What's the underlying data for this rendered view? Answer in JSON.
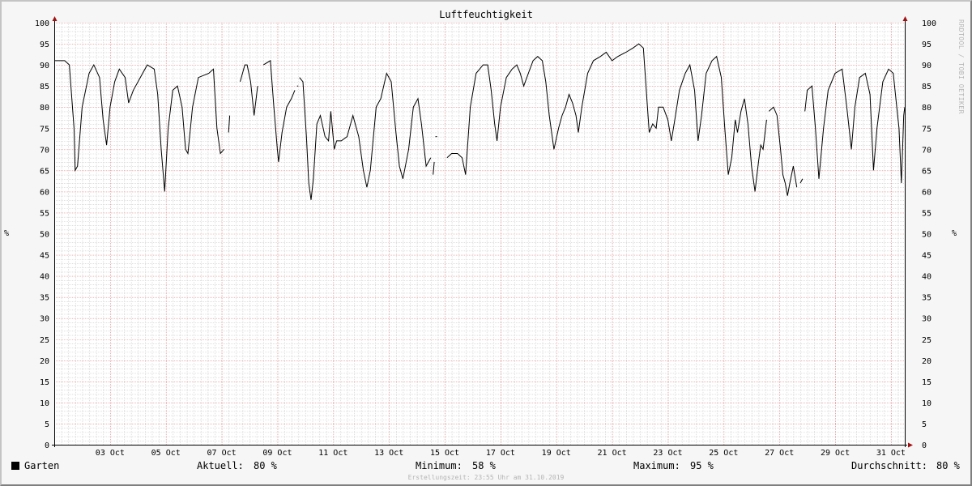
{
  "chart_data": {
    "type": "line",
    "title": "Luftfeuchtigkeit",
    "ylabel": "%",
    "ylim": [
      0,
      100
    ],
    "y_ticks": [
      0,
      5,
      10,
      15,
      20,
      25,
      30,
      35,
      40,
      45,
      50,
      55,
      60,
      65,
      70,
      75,
      80,
      85,
      90,
      95,
      100
    ],
    "x_range": [
      "2019-10-01T12:00",
      "2019-10-31T23:55"
    ],
    "x_ticks": [
      {
        "date": "2019-10-03",
        "label": "03 Oct"
      },
      {
        "date": "2019-10-05",
        "label": "05 Oct"
      },
      {
        "date": "2019-10-07",
        "label": "07 Oct"
      },
      {
        "date": "2019-10-09",
        "label": "09 Oct"
      },
      {
        "date": "2019-10-11",
        "label": "11 Oct"
      },
      {
        "date": "2019-10-13",
        "label": "13 Oct"
      },
      {
        "date": "2019-10-15",
        "label": "15 Oct"
      },
      {
        "date": "2019-10-17",
        "label": "17 Oct"
      },
      {
        "date": "2019-10-19",
        "label": "19 Oct"
      },
      {
        "date": "2019-10-21",
        "label": "21 Oct"
      },
      {
        "date": "2019-10-23",
        "label": "23 Oct"
      },
      {
        "date": "2019-10-25",
        "label": "25 Oct"
      },
      {
        "date": "2019-10-27",
        "label": "27 Oct"
      },
      {
        "date": "2019-10-29",
        "label": "29 Oct"
      },
      {
        "date": "2019-10-31",
        "label": "31 Oct"
      }
    ],
    "grid": true,
    "series": [
      {
        "name": "Garten",
        "color": "#000000",
        "segments": [
          [
            [
              "2019-10-01T12:00",
              91
            ],
            [
              "2019-10-01T21:00",
              91
            ],
            [
              "2019-10-02T01:00",
              90
            ],
            [
              "2019-10-02T05:00",
              75
            ],
            [
              "2019-10-02T06:00",
              65
            ],
            [
              "2019-10-02T08:00",
              66
            ],
            [
              "2019-10-02T12:00",
              80
            ],
            [
              "2019-10-02T18:00",
              88
            ],
            [
              "2019-10-02T22:00",
              90
            ],
            [
              "2019-10-03T03:00",
              87
            ],
            [
              "2019-10-03T06:00",
              77
            ],
            [
              "2019-10-03T09:00",
              71
            ],
            [
              "2019-10-03T12:00",
              80
            ],
            [
              "2019-10-03T16:00",
              86
            ],
            [
              "2019-10-03T20:00",
              89
            ],
            [
              "2019-10-04T01:00",
              87
            ],
            [
              "2019-10-04T04:00",
              81
            ],
            [
              "2019-10-04T08:00",
              84
            ],
            [
              "2019-10-04T14:00",
              87
            ],
            [
              "2019-10-04T20:00",
              90
            ],
            [
              "2019-10-05T02:00",
              89
            ],
            [
              "2019-10-05T05:00",
              83
            ],
            [
              "2019-10-05T08:00",
              70
            ],
            [
              "2019-10-05T11:00",
              60
            ],
            [
              "2019-10-05T14:00",
              75
            ],
            [
              "2019-10-05T18:00",
              84
            ],
            [
              "2019-10-05T22:00",
              85
            ],
            [
              "2019-10-06T02:00",
              80
            ],
            [
              "2019-10-06T05:00",
              70
            ],
            [
              "2019-10-06T07:00",
              69
            ],
            [
              "2019-10-06T11:00",
              80
            ],
            [
              "2019-10-06T16:00",
              87
            ],
            [
              "2019-10-07T01:00",
              88
            ],
            [
              "2019-10-07T05:00",
              89
            ],
            [
              "2019-10-07T08:00",
              75
            ],
            [
              "2019-10-07T11:00",
              69
            ],
            [
              "2019-10-07T14:00",
              70
            ]
          ],
          [
            [
              "2019-10-07T18:00",
              74
            ],
            [
              "2019-10-07T19:00",
              78
            ]
          ],
          [
            [
              "2019-10-08T04:00",
              86
            ],
            [
              "2019-10-08T06:00",
              88
            ],
            [
              "2019-10-08T08:00",
              90
            ],
            [
              "2019-10-08T10:00",
              90
            ],
            [
              "2019-10-08T13:00",
              86
            ],
            [
              "2019-10-08T16:00",
              78
            ],
            [
              "2019-10-08T19:00",
              85
            ]
          ],
          [
            [
              "2019-10-09T00:00",
              90
            ],
            [
              "2019-10-09T06:00",
              91
            ],
            [
              "2019-10-09T09:00",
              80
            ],
            [
              "2019-10-09T12:00",
              70
            ],
            [
              "2019-10-09T13:00",
              67
            ],
            [
              "2019-10-09T16:00",
              74
            ],
            [
              "2019-10-09T20:00",
              80
            ],
            [
              "2019-10-10T00:00",
              82
            ],
            [
              "2019-10-10T03:00",
              84
            ]
          ],
          [
            [
              "2019-10-10T05:00",
              85
            ],
            [
              "2019-10-10T06:00",
              85
            ]
          ],
          [
            [
              "2019-10-10T07:00",
              87
            ],
            [
              "2019-10-10T10:00",
              86
            ],
            [
              "2019-10-10T13:00",
              73
            ],
            [
              "2019-10-10T15:00",
              62
            ],
            [
              "2019-10-10T17:00",
              58
            ],
            [
              "2019-10-10T19:00",
              63
            ],
            [
              "2019-10-10T22:00",
              76
            ],
            [
              "2019-10-11T01:00",
              78
            ],
            [
              "2019-10-11T05:00",
              73
            ],
            [
              "2019-10-11T08:00",
              72
            ],
            [
              "2019-10-11T10:00",
              79
            ],
            [
              "2019-10-11T13:00",
              70
            ],
            [
              "2019-10-11T15:00",
              72
            ],
            [
              "2019-10-11T19:00",
              72
            ],
            [
              "2019-10-12T00:00",
              73
            ],
            [
              "2019-10-12T05:00",
              78
            ],
            [
              "2019-10-12T10:00",
              73
            ],
            [
              "2019-10-12T14:00",
              65
            ],
            [
              "2019-10-12T17:00",
              61
            ],
            [
              "2019-10-12T20:00",
              65
            ],
            [
              "2019-10-13T01:00",
              80
            ],
            [
              "2019-10-13T05:00",
              82
            ],
            [
              "2019-10-13T10:00",
              88
            ],
            [
              "2019-10-13T14:00",
              86
            ],
            [
              "2019-10-13T18:00",
              74
            ],
            [
              "2019-10-13T21:00",
              66
            ],
            [
              "2019-10-14T00:00",
              63
            ],
            [
              "2019-10-14T05:00",
              70
            ],
            [
              "2019-10-14T09:00",
              80
            ],
            [
              "2019-10-14T13:00",
              82
            ],
            [
              "2019-10-14T16:00",
              76
            ],
            [
              "2019-10-14T20:00",
              66
            ],
            [
              "2019-10-15T00:00",
              68
            ]
          ],
          [
            [
              "2019-10-15T02:00",
              64
            ],
            [
              "2019-10-15T03:00",
              67
            ]
          ],
          [
            [
              "2019-10-15T04:00",
              73
            ]
          ],
          [
            [
              "2019-10-15T14:00",
              68
            ],
            [
              "2019-10-15T18:00",
              69
            ],
            [
              "2019-10-15T23:00",
              69
            ],
            [
              "2019-10-16T03:00",
              68
            ],
            [
              "2019-10-16T06:00",
              64
            ],
            [
              "2019-10-16T10:00",
              80
            ],
            [
              "2019-10-16T15:00",
              88
            ],
            [
              "2019-10-16T21:00",
              90
            ],
            [
              "2019-10-17T01:00",
              90
            ],
            [
              "2019-10-17T04:00",
              84
            ],
            [
              "2019-10-17T07:00",
              76
            ],
            [
              "2019-10-17T09:00",
              72
            ],
            [
              "2019-10-17T12:00",
              80
            ],
            [
              "2019-10-17T17:00",
              87
            ],
            [
              "2019-10-17T22:00",
              89
            ],
            [
              "2019-10-18T02:00",
              90
            ],
            [
              "2019-10-18T05:00",
              88
            ],
            [
              "2019-10-18T08:00",
              85
            ],
            [
              "2019-10-18T12:00",
              88
            ],
            [
              "2019-10-18T16:00",
              91
            ],
            [
              "2019-10-18T20:00",
              92
            ],
            [
              "2019-10-19T00:00",
              91
            ],
            [
              "2019-10-19T03:00",
              86
            ],
            [
              "2019-10-19T06:00",
              78
            ],
            [
              "2019-10-19T10:00",
              70
            ],
            [
              "2019-10-19T14:00",
              75
            ],
            [
              "2019-10-19T17:00",
              78
            ],
            [
              "2019-10-19T20:00",
              80
            ],
            [
              "2019-10-19T23:00",
              83
            ],
            [
              "2019-10-20T02:00",
              81
            ],
            [
              "2019-10-20T05:00",
              78
            ],
            [
              "2019-10-20T07:00",
              74
            ],
            [
              "2019-10-20T10:00",
              80
            ],
            [
              "2019-10-20T15:00",
              88
            ],
            [
              "2019-10-20T20:00",
              91
            ],
            [
              "2019-10-21T02:00",
              92
            ],
            [
              "2019-10-21T07:00",
              93
            ],
            [
              "2019-10-21T12:00",
              91
            ],
            [
              "2019-10-21T17:00",
              92
            ],
            [
              "2019-10-22T00:00",
              93
            ],
            [
              "2019-10-22T06:00",
              94
            ],
            [
              "2019-10-22T11:00",
              95
            ],
            [
              "2019-10-22T15:00",
              94
            ],
            [
              "2019-10-22T18:00",
              82
            ],
            [
              "2019-10-22T20:00",
              74
            ],
            [
              "2019-10-22T23:00",
              76
            ],
            [
              "2019-10-23T02:00",
              75
            ],
            [
              "2019-10-23T04:00",
              80
            ],
            [
              "2019-10-23T08:00",
              80
            ],
            [
              "2019-10-23T12:00",
              77
            ],
            [
              "2019-10-23T15:00",
              72
            ],
            [
              "2019-10-23T18:00",
              77
            ],
            [
              "2019-10-23T22:00",
              84
            ],
            [
              "2019-10-24T03:00",
              88
            ],
            [
              "2019-10-24T07:00",
              90
            ],
            [
              "2019-10-24T11:00",
              84
            ],
            [
              "2019-10-24T14:00",
              72
            ],
            [
              "2019-10-24T17:00",
              78
            ],
            [
              "2019-10-24T21:00",
              88
            ],
            [
              "2019-10-25T02:00",
              91
            ],
            [
              "2019-10-25T06:00",
              92
            ],
            [
              "2019-10-25T10:00",
              87
            ],
            [
              "2019-10-25T13:00",
              75
            ],
            [
              "2019-10-25T16:00",
              64
            ],
            [
              "2019-10-25T19:00",
              68
            ],
            [
              "2019-10-25T22:00",
              77
            ],
            [
              "2019-10-26T00:00",
              74
            ],
            [
              "2019-10-26T03:00",
              79
            ],
            [
              "2019-10-26T06:00",
              82
            ],
            [
              "2019-10-26T09:00",
              76
            ],
            [
              "2019-10-26T12:00",
              66
            ],
            [
              "2019-10-26T15:00",
              60
            ],
            [
              "2019-10-26T18:00",
              67
            ],
            [
              "2019-10-26T20:00",
              71
            ],
            [
              "2019-10-26T22:00",
              70
            ],
            [
              "2019-10-27T01:00",
              77
            ]
          ],
          [
            [
              "2019-10-27T03:00",
              79
            ],
            [
              "2019-10-27T07:00",
              80
            ],
            [
              "2019-10-27T10:00",
              78
            ],
            [
              "2019-10-27T13:00",
              70
            ],
            [
              "2019-10-27T15:00",
              64
            ],
            [
              "2019-10-27T17:00",
              62
            ],
            [
              "2019-10-27T19:00",
              59
            ],
            [
              "2019-10-27T21:00",
              62
            ],
            [
              "2019-10-28T00:00",
              66
            ],
            [
              "2019-10-28T03:00",
              61
            ]
          ],
          [
            [
              "2019-10-28T06:00",
              62
            ],
            [
              "2019-10-28T08:00",
              63
            ]
          ],
          [
            [
              "2019-10-28T10:00",
              79
            ],
            [
              "2019-10-28T12:00",
              84
            ],
            [
              "2019-10-28T16:00",
              85
            ],
            [
              "2019-10-28T19:00",
              75
            ],
            [
              "2019-10-28T22:00",
              63
            ],
            [
              "2019-10-29T02:00",
              75
            ],
            [
              "2019-10-29T06:00",
              84
            ],
            [
              "2019-10-29T12:00",
              88
            ],
            [
              "2019-10-29T18:00",
              89
            ],
            [
              "2019-10-29T22:00",
              80
            ],
            [
              "2019-10-30T02:00",
              70
            ],
            [
              "2019-10-30T05:00",
              80
            ],
            [
              "2019-10-30T09:00",
              87
            ],
            [
              "2019-10-30T14:00",
              88
            ],
            [
              "2019-10-30T18:00",
              83
            ],
            [
              "2019-10-30T21:00",
              65
            ],
            [
              "2019-10-31T00:00",
              75
            ],
            [
              "2019-10-31T05:00",
              86
            ],
            [
              "2019-10-31T10:00",
              89
            ],
            [
              "2019-10-31T14:00",
              88
            ],
            [
              "2019-10-31T17:00",
              80
            ],
            [
              "2019-10-31T19:00",
              75
            ],
            [
              "2019-10-31T21:00",
              62
            ],
            [
              "2019-10-31T22:00",
              70
            ],
            [
              "2019-10-31T23:00",
              78
            ],
            [
              "2019-10-31T23:55",
              80
            ]
          ]
        ]
      }
    ]
  },
  "side_label": "RRDTOOL / TOBI OETIKER",
  "legend": {
    "series_name": "Garten",
    "current_label": "Aktuell:",
    "current_value": "80 %",
    "min_label": "Minimum:",
    "min_value": "58 %",
    "max_label": "Maximum:",
    "max_value": "95 %",
    "avg_label": "Durchschnitt:",
    "avg_value": "80 %"
  },
  "footer": "Erstellungszeit: 23:55 Uhr am 31.10.2019",
  "colors": {
    "plot_background": "#ffffff",
    "minor_grid": "#cccccc",
    "major_grid": "#e08a8a",
    "axis": "#000000",
    "arrow": "#a01010",
    "line": "#000000"
  }
}
